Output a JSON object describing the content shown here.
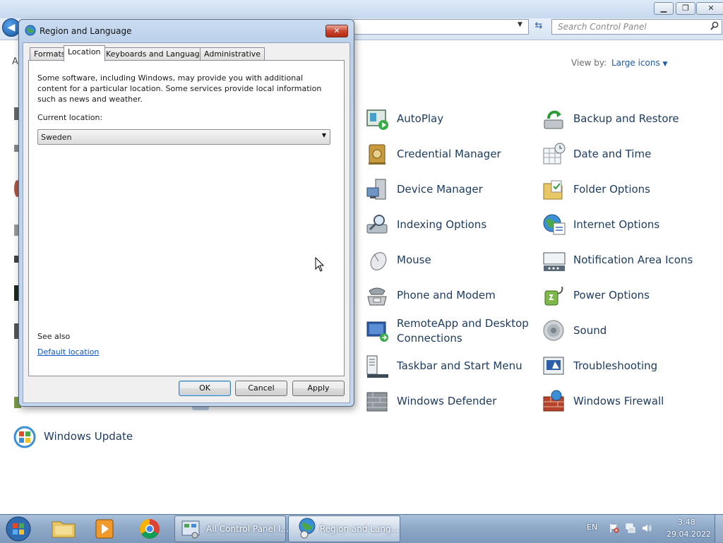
{
  "control_panel": {
    "search_placeholder": "Search Control Panel",
    "view_by_label": "View by:",
    "view_by_value": "Large icons",
    "items": [
      {
        "label": "AutoPlay",
        "icon": "autoplay-icon"
      },
      {
        "label": "Backup and Restore",
        "icon": "backup-restore-icon"
      },
      {
        "label": "Credential Manager",
        "icon": "credential-manager-icon"
      },
      {
        "label": "Date and Time",
        "icon": "date-time-icon"
      },
      {
        "label": "Device Manager",
        "icon": "device-manager-icon"
      },
      {
        "label": "Folder Options",
        "icon": "folder-options-icon"
      },
      {
        "label": "Indexing Options",
        "icon": "indexing-options-icon"
      },
      {
        "label": "Internet Options",
        "icon": "internet-options-icon"
      },
      {
        "label": "Mouse",
        "icon": "mouse-icon"
      },
      {
        "label": "Notification Area Icons",
        "icon": "notification-area-icon"
      },
      {
        "label": "Phone and Modem",
        "icon": "phone-modem-icon"
      },
      {
        "label": "Power Options",
        "icon": "power-options-icon"
      },
      {
        "label": "RemoteApp and Desktop",
        "label2": "Connections",
        "icon": "remoteapp-icon"
      },
      {
        "label": "Sound",
        "icon": "sound-icon"
      },
      {
        "label": "Taskbar and Start Menu",
        "icon": "taskbar-start-icon"
      },
      {
        "label": "Troubleshooting",
        "icon": "troubleshooting-icon"
      },
      {
        "label": "Windows Defender",
        "icon": "windows-defender-icon"
      },
      {
        "label": "Windows Firewall",
        "icon": "windows-firewall-icon"
      },
      {
        "label": "Windows Update",
        "icon": "windows-update-icon"
      }
    ]
  },
  "dialog": {
    "title": "Region and Language",
    "tabs": [
      "Formats",
      "Location",
      "Keyboards and Languages",
      "Administrative"
    ],
    "active_tab": "Location",
    "info_text": "Some software, including Windows, may provide you with additional content for a particular location. Some services provide local information such as news and weather.",
    "current_location_label": "Current location:",
    "current_location_value": "Sweden",
    "see_also": "See also",
    "default_location_link": "Default location",
    "buttons": {
      "ok": "OK",
      "cancel": "Cancel",
      "apply": "Apply"
    }
  },
  "taskbar": {
    "tasks": [
      {
        "label": "All Control Panel I...",
        "icon": "control-panel-icon",
        "active": false
      },
      {
        "label": "Region and Lang...",
        "icon": "region-language-icon",
        "active": true
      }
    ],
    "language": "EN",
    "clock_time": "3:48",
    "clock_date": "29.04.2022"
  },
  "colors": {
    "link": "#0b55c9",
    "cp_label": "#1e3c61",
    "taskbar": "#8fa9c8"
  }
}
